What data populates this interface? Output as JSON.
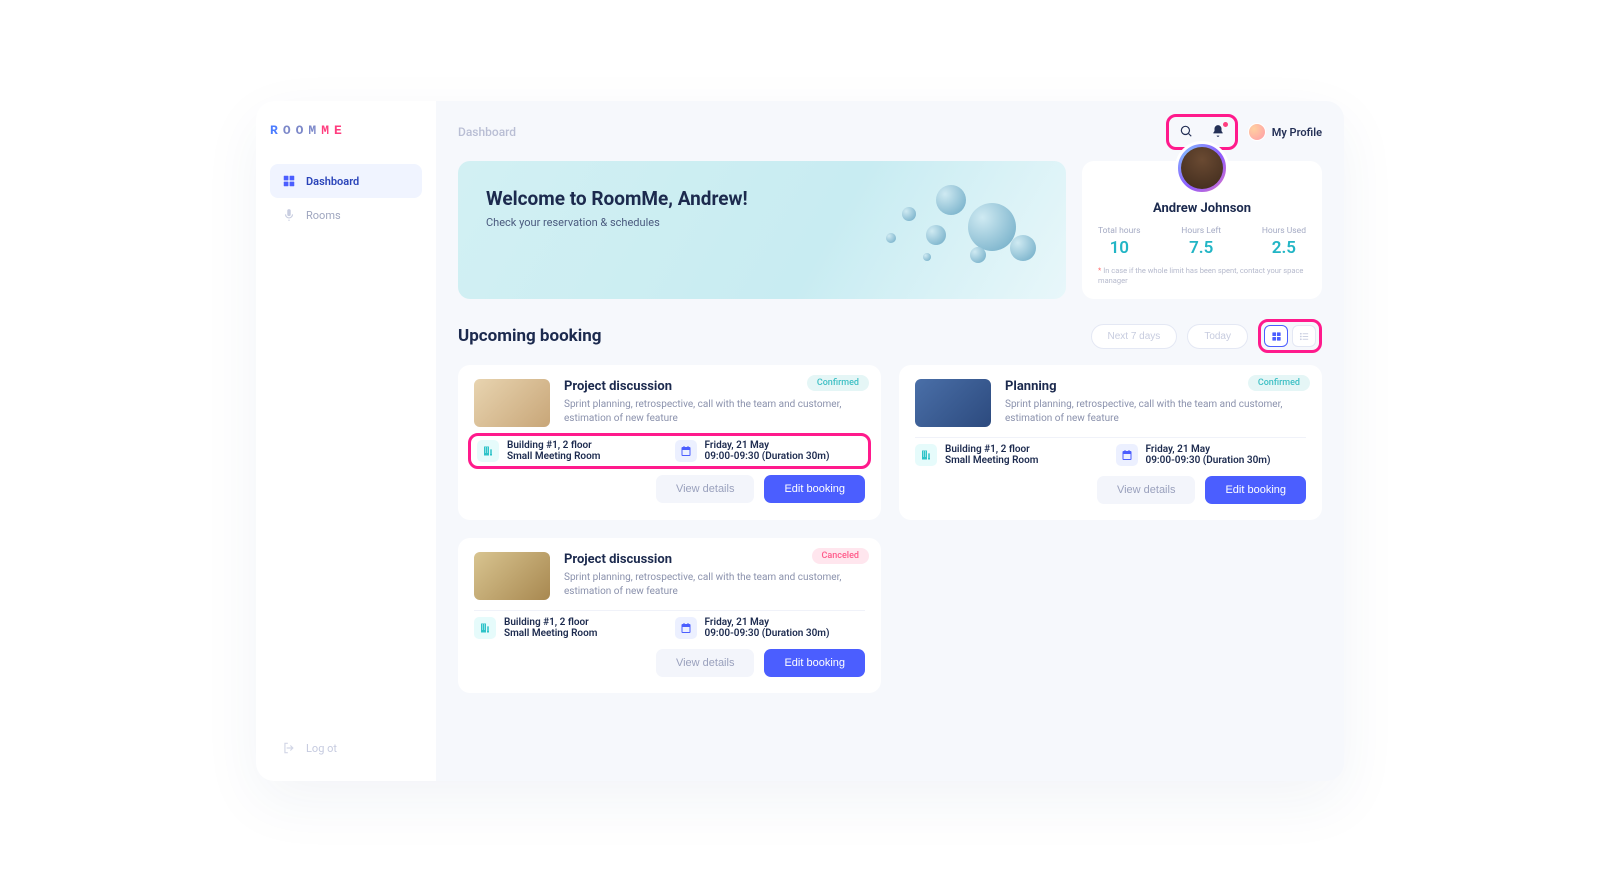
{
  "brand": {
    "text": "ROOMME"
  },
  "sidebar": {
    "items": [
      {
        "label": "Dashboard",
        "active": true
      },
      {
        "label": "Rooms",
        "active": false
      }
    ],
    "logout_label": "Log ot"
  },
  "header": {
    "title": "Dashboard",
    "profile_link": "My Profile"
  },
  "welcome": {
    "heading": "Welcome to RoomMe, Andrew!",
    "sub": "Check your reservation & schedules"
  },
  "profile": {
    "name": "Andrew Johnson",
    "stats": [
      {
        "label": "Total hours",
        "value": "10"
      },
      {
        "label": "Hours Left",
        "value": "7.5"
      },
      {
        "label": "Hours Used",
        "value": "2.5"
      }
    ],
    "note": "In case if the whole limit has been spent, contact your space manager"
  },
  "upcoming": {
    "title": "Upcoming booking",
    "filters": {
      "range": "Next 7 days",
      "today": "Today"
    },
    "actions": {
      "view": "View details",
      "edit": "Edit booking"
    },
    "bookings": [
      {
        "title": "Project discussion",
        "desc": "Sprint planning, retrospective, call with the team and customer, estimation of new feature",
        "status": "Confirmed",
        "location_line1": "Building #1, 2 floor",
        "location_line2": "Small Meeting Room",
        "date_line1": "Friday,  21 May",
        "date_line2": "09:00-09:30 (Duration 30m)",
        "highlight_meta": true,
        "thumb": "wood"
      },
      {
        "title": "Planning",
        "desc": "Sprint planning, retrospective, call with the team and customer, estimation of new feature",
        "status": "Confirmed",
        "location_line1": "Building #1, 2 floor",
        "location_line2": "Small Meeting Room",
        "date_line1": "Friday,  21 May",
        "date_line2": "09:00-09:30 (Duration 30m)",
        "highlight_meta": false,
        "thumb": "blue"
      },
      {
        "title": "Project discussion",
        "desc": "Sprint planning, retrospective, call with the team and customer, estimation of new feature",
        "status": "Canceled",
        "location_line1": "Building #1, 2 floor",
        "location_line2": "Small Meeting Room",
        "date_line1": "Friday,  21 May",
        "date_line2": "09:00-09:30 (Duration 30m)",
        "highlight_meta": false,
        "thumb": "lobby"
      }
    ]
  }
}
